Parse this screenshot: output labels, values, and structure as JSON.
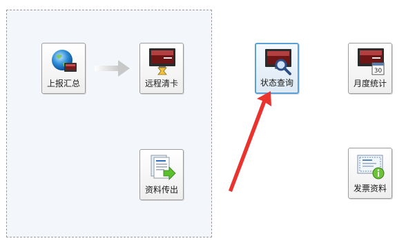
{
  "tiles": {
    "report_summary": {
      "label": "上报汇总"
    },
    "remote_clear": {
      "label": "远程清卡"
    },
    "data_export": {
      "label": "资料传出"
    },
    "status_query": {
      "label": "状态查询"
    },
    "monthly_stats": {
      "label": "月度统计",
      "calendar_day": "30"
    },
    "invoice_data": {
      "label": "发票资料"
    }
  },
  "colors": {
    "panel_bg": "#f3f6fb",
    "selected_border": "#5aa0d6",
    "highlight_arrow": "#e8332e",
    "flow_arrow": "#c8c8c8"
  }
}
